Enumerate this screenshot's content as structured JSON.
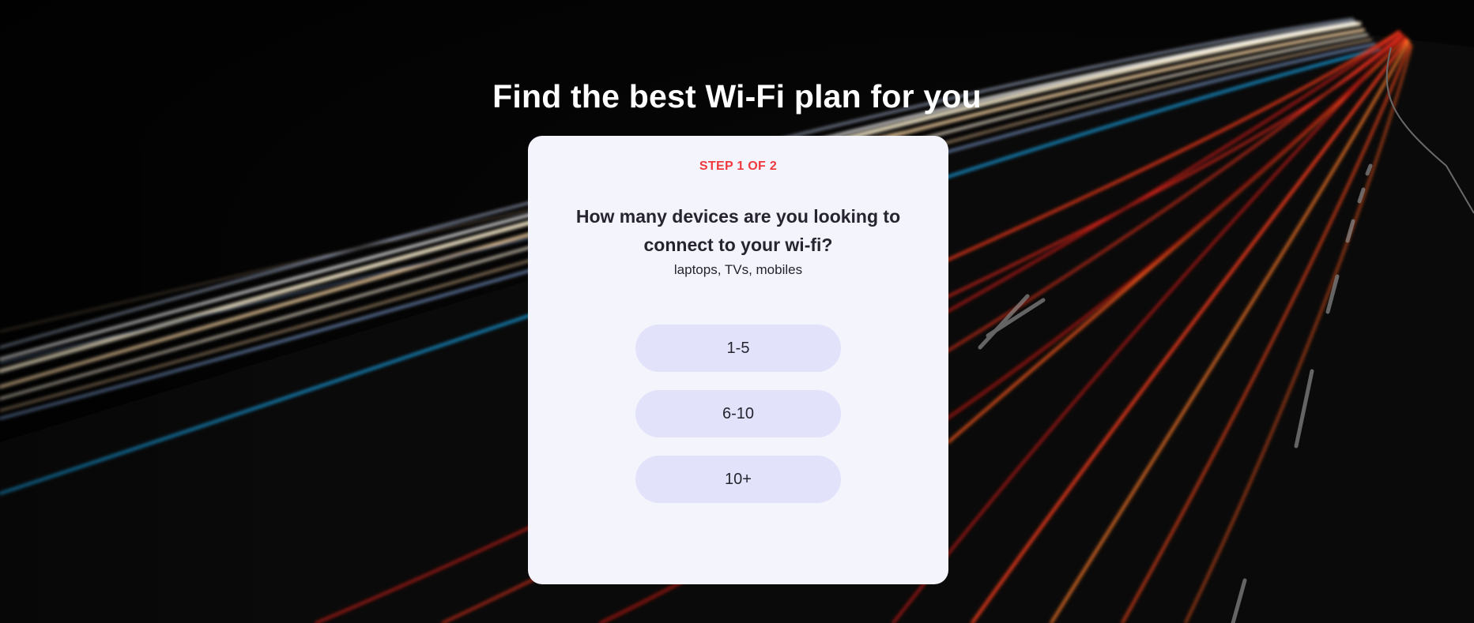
{
  "page": {
    "headline": "Find the best Wi-Fi plan for you"
  },
  "quiz": {
    "step_label": "STEP 1 OF 2",
    "question": "How many devices are you looking to connect to your wi-fi?",
    "hint": "laptops, TVs, mobiles",
    "options": [
      {
        "label": "1-5"
      },
      {
        "label": "6-10"
      },
      {
        "label": "10+"
      }
    ]
  },
  "colors": {
    "step_accent": "#f0393f",
    "card_background": "#f4f4fc",
    "option_background": "#e2e3fb",
    "text": "#25242f"
  }
}
